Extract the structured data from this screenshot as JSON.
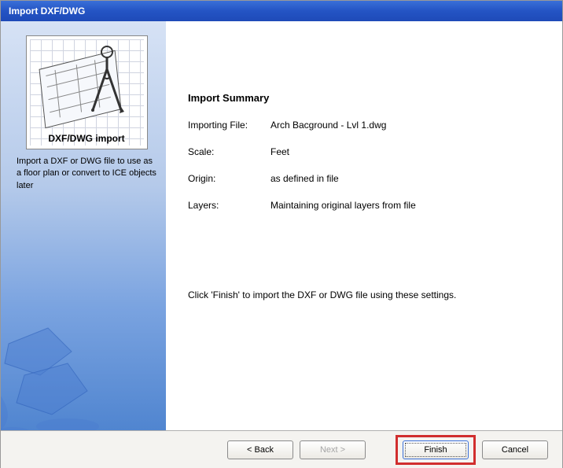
{
  "window": {
    "title": "Import DXF/DWG"
  },
  "sidebar": {
    "illustration_label": "DXF/DWG import",
    "description": "Import a DXF or DWG file to use as a floor plan or convert to ICE objects later"
  },
  "summary": {
    "heading": "Import Summary",
    "rows": [
      {
        "label": "Importing File:",
        "value": "Arch Bacground - Lvl 1.dwg"
      },
      {
        "label": "Scale:",
        "value": "Feet"
      },
      {
        "label": "Origin:",
        "value": "as defined in file"
      },
      {
        "label": "Layers:",
        "value": "Maintaining original layers from file"
      }
    ],
    "instruction": "Click 'Finish' to import the DXF or DWG file using these settings."
  },
  "buttons": {
    "back": "< Back",
    "next": "Next >",
    "finish": "Finish",
    "cancel": "Cancel"
  }
}
